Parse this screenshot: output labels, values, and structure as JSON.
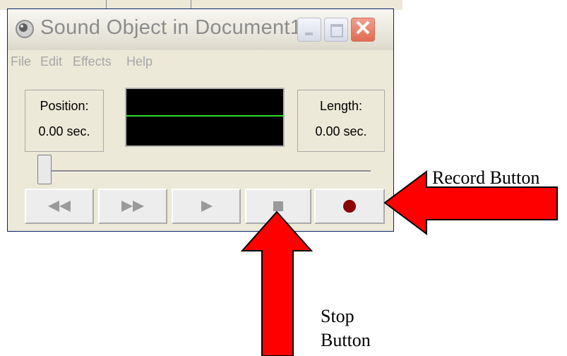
{
  "window": {
    "title": "Sound Object in Document1",
    "menu": [
      {
        "label": "File"
      },
      {
        "label": "Edit"
      },
      {
        "label": "Effects"
      },
      {
        "label": "Help"
      }
    ]
  },
  "position": {
    "label": "Position:",
    "value": "0.00 sec."
  },
  "length": {
    "label": "Length:",
    "value": "0.00 sec."
  },
  "slider": {
    "value_fraction": 0.0
  },
  "controls": [
    {
      "name": "rewind",
      "icon": "rewind-icon"
    },
    {
      "name": "fast-forward",
      "icon": "fast-forward-icon"
    },
    {
      "name": "play",
      "icon": "play-icon"
    },
    {
      "name": "stop",
      "icon": "stop-icon"
    },
    {
      "name": "record",
      "icon": "record-icon"
    }
  ],
  "annotations": {
    "record_label": "Record Button",
    "stop_label_line1": "Stop",
    "stop_label_line2": "Button"
  },
  "colors": {
    "arrow_fill": "#ff0000",
    "record_dot": "#8b0000",
    "waveform_line": "#2cdd2c"
  }
}
